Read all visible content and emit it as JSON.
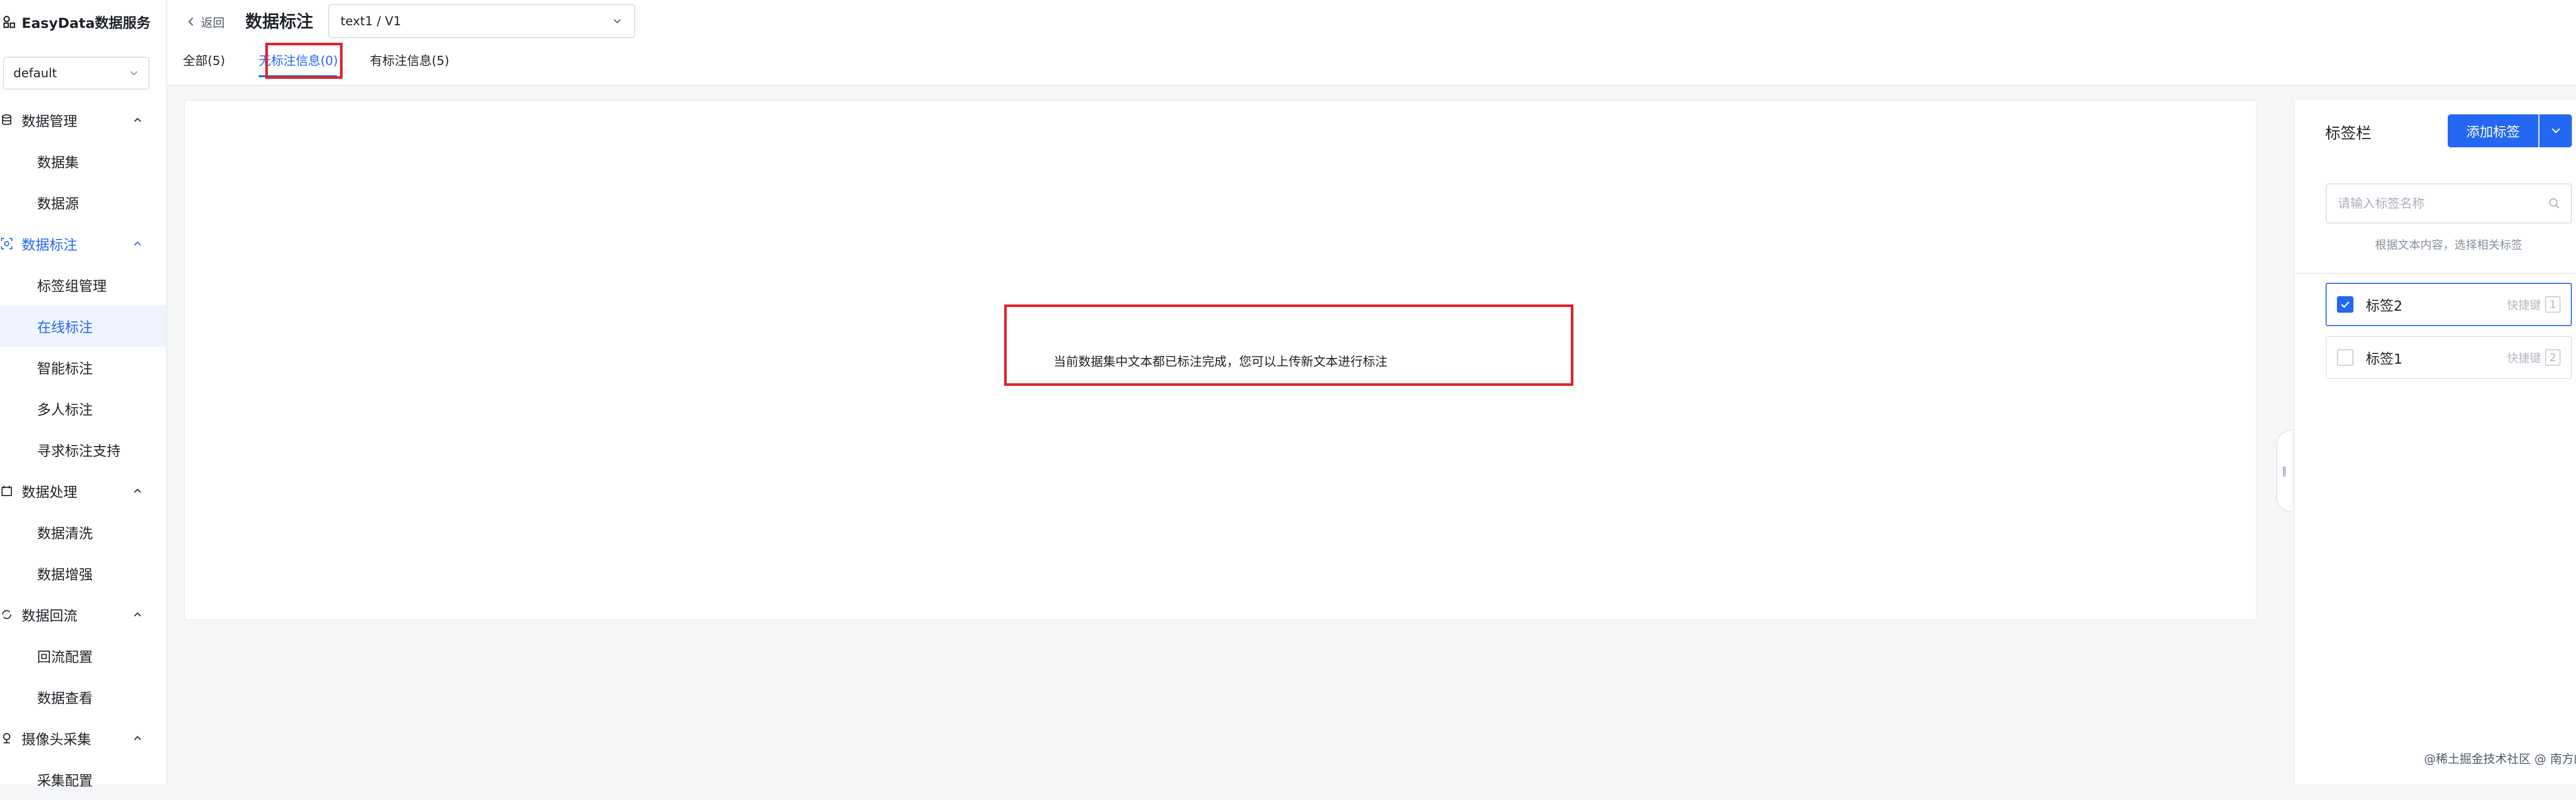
{
  "app": {
    "brand": "EasyData数据服务",
    "workspace": "default"
  },
  "sidebar": {
    "groups": [
      {
        "label": "数据管理",
        "icon": "database-icon",
        "items": [
          "数据集",
          "数据源"
        ]
      },
      {
        "label": "数据标注",
        "icon": "annotate-icon",
        "items": [
          "标签组管理",
          "在线标注",
          "智能标注",
          "多人标注",
          "寻求标注支持"
        ]
      },
      {
        "label": "数据处理",
        "icon": "process-icon",
        "items": [
          "数据清洗",
          "数据增强"
        ]
      },
      {
        "label": "数据回流",
        "icon": "reflow-icon",
        "items": [
          "回流配置",
          "数据查看"
        ]
      },
      {
        "label": "摄像头采集",
        "icon": "camera-icon",
        "items": [
          "采集配置"
        ]
      }
    ],
    "active_item": "在线标注"
  },
  "header": {
    "back_label": "返回",
    "title": "数据标注",
    "version_select": "text1 / V1",
    "tabs": [
      {
        "label": "全部(5)"
      },
      {
        "label": "无标注信息(0)"
      },
      {
        "label": "有标注信息(5)"
      }
    ],
    "active_tab": 1
  },
  "main": {
    "empty_message": "当前数据集中文本都已标注完成，您可以上传新文本进行标注"
  },
  "label_panel": {
    "title": "标签栏",
    "add_button": "添加标签",
    "search_placeholder": "请输入标签名称",
    "hint": "根据文本内容，选择相关标签",
    "shortcut_label": "快捷键",
    "labels": [
      {
        "name": "标签2",
        "key": "1",
        "checked": true
      },
      {
        "name": "标签1",
        "key": "2",
        "checked": false
      }
    ]
  },
  "footer": {
    "watermark": "@稀土掘金技术社区 @ 南方的耳朵"
  },
  "colors": {
    "accent": "#2468f2",
    "highlight": "#d9252a"
  }
}
